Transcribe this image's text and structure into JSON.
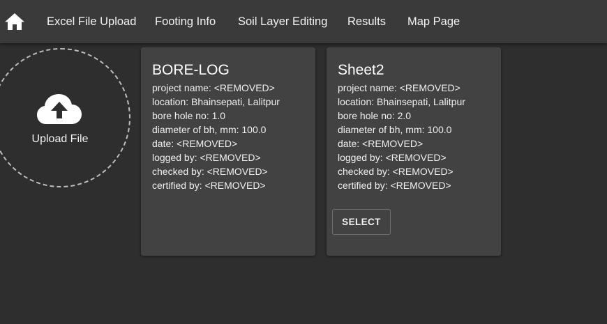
{
  "nav": {
    "home_icon": "home-icon",
    "items": [
      {
        "label": "Excel File Upload"
      },
      {
        "label": "Footing Info"
      },
      {
        "label": "Soil Layer Editing"
      },
      {
        "label": "Results"
      },
      {
        "label": "Map Page"
      }
    ]
  },
  "upload": {
    "icon": "cloud-upload-icon",
    "label": "Upload File"
  },
  "cards": [
    {
      "title": "BORE-LOG",
      "lines": [
        "project name: <REMOVED>",
        "location: Bhainsepati, Lalitpur",
        "bore hole no: 1.0",
        "diameter of bh, mm: 100.0",
        "date: <REMOVED>",
        "logged by: <REMOVED>",
        "checked by: <REMOVED>",
        "certified by: <REMOVED>"
      ]
    },
    {
      "title": "Sheet2",
      "lines": [
        "project name: <REMOVED>",
        "location: Bhainsepati, Lalitpur",
        "bore hole no: 2.0",
        "diameter of bh, mm: 100.0",
        "date: <REMOVED>",
        "logged by: <REMOVED>",
        "checked by: <REMOVED>",
        "certified by: <REMOVED>"
      ],
      "button_label": "SELECT"
    }
  ],
  "colors": {
    "background": "#2e2e2e",
    "appbar": "#3a3a3a",
    "card": "#424242",
    "text": "#ffffff"
  }
}
